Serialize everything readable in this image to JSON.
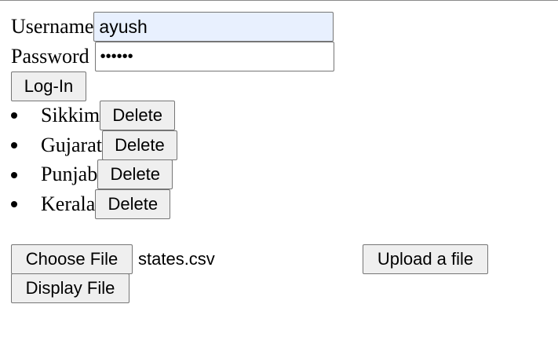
{
  "login": {
    "username_label": "Username",
    "username_value": "ayush",
    "password_label": "Password",
    "password_value": "••••••",
    "login_button": "Log-In"
  },
  "states": {
    "delete_label": "Delete",
    "items": [
      {
        "name": "Sikkim"
      },
      {
        "name": "Gujarat"
      },
      {
        "name": "Punjab"
      },
      {
        "name": "Kerala"
      }
    ]
  },
  "file": {
    "choose_button": "Choose File",
    "selected_name": "states.csv",
    "upload_button": "Upload a file",
    "display_button": "Display File"
  }
}
